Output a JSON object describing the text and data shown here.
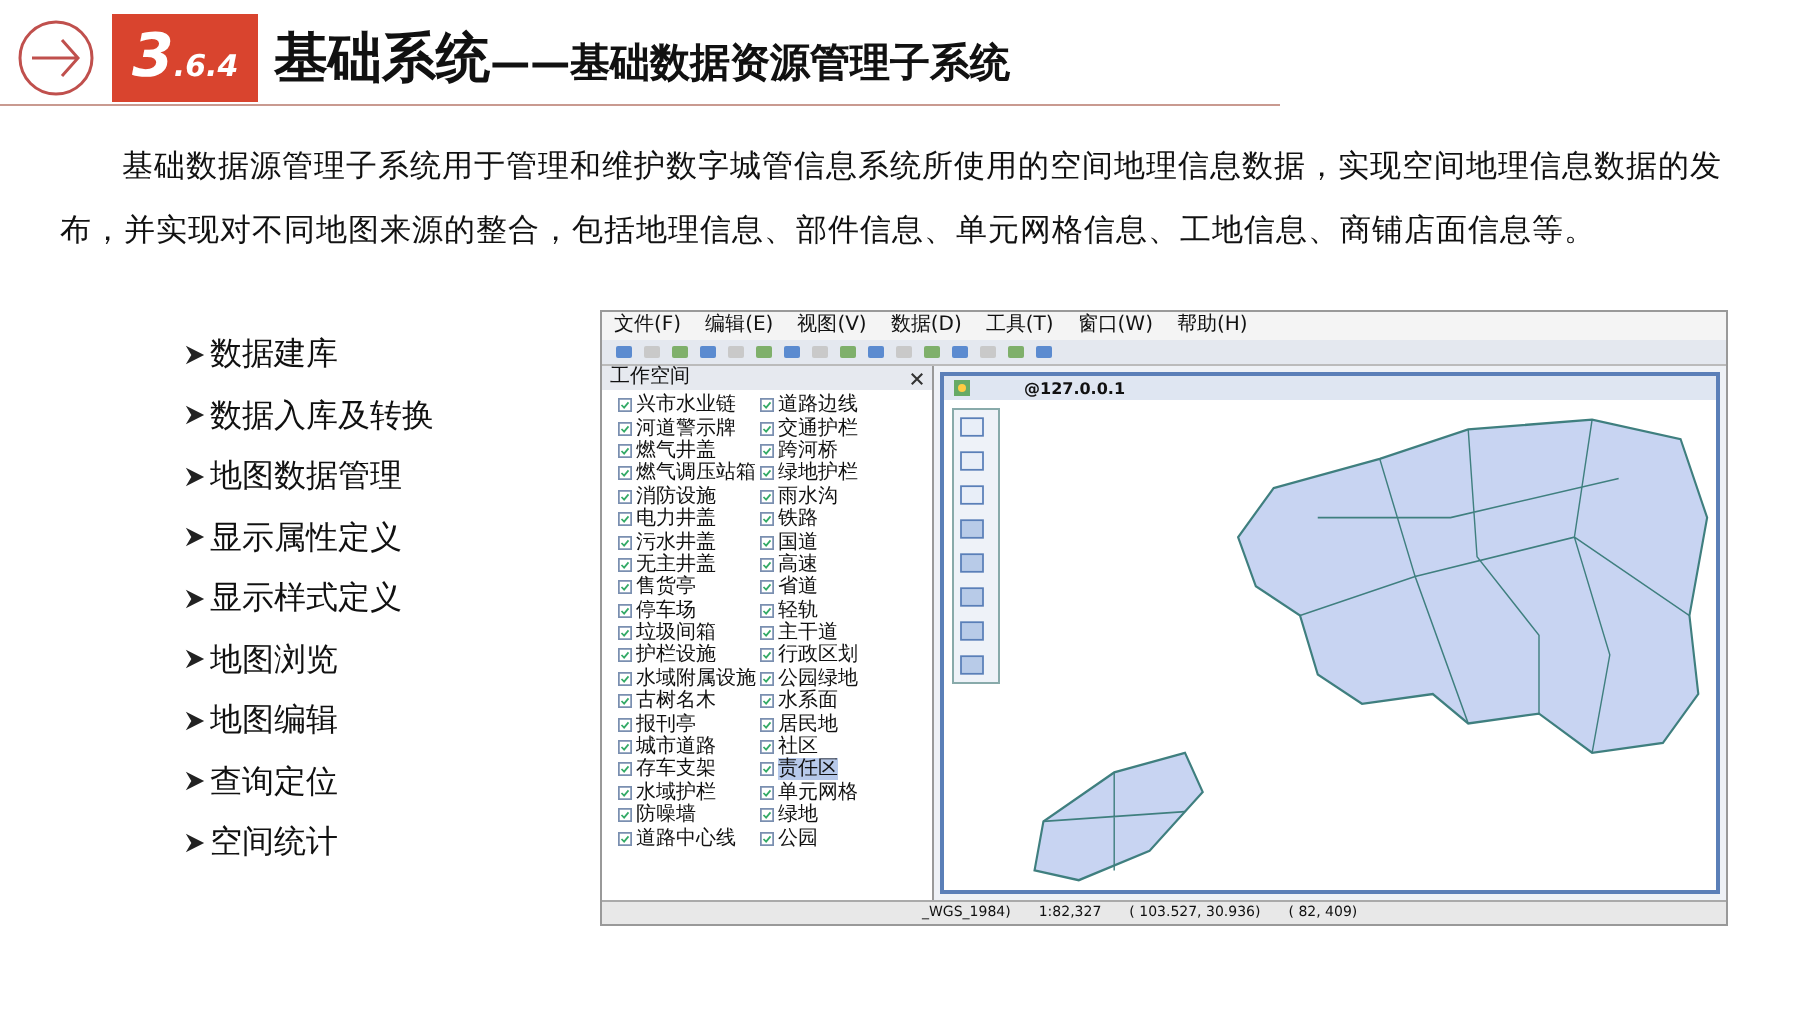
{
  "header": {
    "number": "3",
    "number_sub": ".6.4",
    "title_main": "基础系统",
    "title_sub": "——基础数据资源管理子系统"
  },
  "intro": "基础数据源管理子系统用于管理和维护数字城管信息系统所使用的空间地理信息数据，实现空间地理信息数据的发布，并实现对不同地图来源的整合，包括地理信息、部件信息、单元网格信息、工地信息、商铺店面信息等。",
  "features": [
    "数据建库",
    "数据入库及转换",
    "地图数据管理",
    "显示属性定义",
    "显示样式定义",
    "地图浏览",
    "地图编辑",
    "查询定位",
    "空间统计"
  ],
  "app": {
    "menu": [
      "文件(F)",
      "编辑(E)",
      "视图(V)",
      "数据(D)",
      "工具(T)",
      "窗口(W)",
      "帮助(H)"
    ],
    "workspace_title": "工作空间",
    "layers": [
      {
        "label": "兴市水业链",
        "selected": false
      },
      {
        "label": "河道警示牌",
        "selected": false
      },
      {
        "label": "燃气井盖",
        "selected": false
      },
      {
        "label": "燃气调压站箱",
        "selected": false
      },
      {
        "label": "消防设施",
        "selected": false
      },
      {
        "label": "电力井盖",
        "selected": false
      },
      {
        "label": "污水井盖",
        "selected": false
      },
      {
        "label": "无主井盖",
        "selected": false
      },
      {
        "label": "售货亭",
        "selected": false
      },
      {
        "label": "停车场",
        "selected": false
      },
      {
        "label": "垃圾间箱",
        "selected": false
      },
      {
        "label": "护栏设施",
        "selected": false
      },
      {
        "label": "水域附属设施",
        "selected": false
      },
      {
        "label": "古树名木",
        "selected": false
      },
      {
        "label": "报刊亭",
        "selected": false
      },
      {
        "label": "城市道路",
        "selected": false
      },
      {
        "label": "存车支架",
        "selected": false
      },
      {
        "label": "水域护栏",
        "selected": false
      },
      {
        "label": "防噪墙",
        "selected": false
      },
      {
        "label": "道路中心线",
        "selected": false
      },
      {
        "label": "道路边线",
        "selected": false
      },
      {
        "label": "交通护栏",
        "selected": false
      },
      {
        "label": "跨河桥",
        "selected": false
      },
      {
        "label": "绿地护栏",
        "selected": false
      },
      {
        "label": "雨水沟",
        "selected": false
      },
      {
        "label": "铁路",
        "selected": false
      },
      {
        "label": "国道",
        "selected": false
      },
      {
        "label": "高速",
        "selected": false
      },
      {
        "label": "省道",
        "selected": false
      },
      {
        "label": "轻轨",
        "selected": false
      },
      {
        "label": "主干道",
        "selected": false
      },
      {
        "label": "行政区划",
        "selected": false
      },
      {
        "label": "公园绿地",
        "selected": false
      },
      {
        "label": "水系面",
        "selected": false
      },
      {
        "label": "居民地",
        "selected": false
      },
      {
        "label": "社区",
        "selected": false
      },
      {
        "label": "责任区",
        "selected": true
      },
      {
        "label": "单元网格",
        "selected": false
      },
      {
        "label": "绿地",
        "selected": false
      },
      {
        "label": "公园",
        "selected": false
      }
    ],
    "map_title": "@127.0.0.1",
    "status": [
      "_WGS_1984)",
      "1:82,327",
      "( 103.527, 30.936)",
      "( 82, 409)"
    ]
  }
}
